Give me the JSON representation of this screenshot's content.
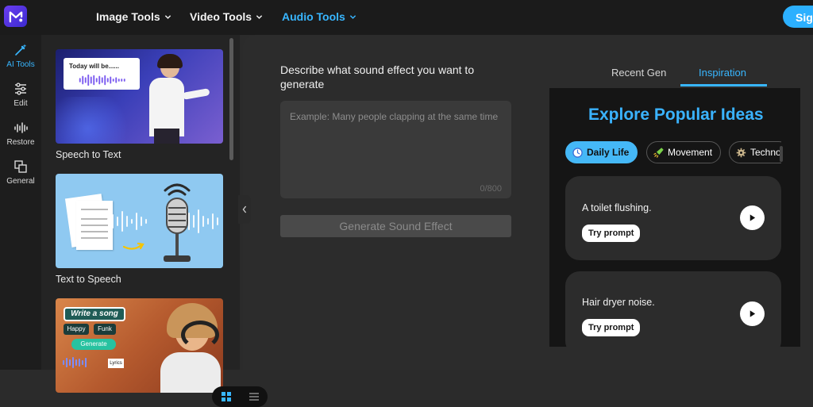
{
  "header": {
    "nav": [
      {
        "label": "Image Tools"
      },
      {
        "label": "Video Tools"
      },
      {
        "label": "Audio Tools"
      }
    ],
    "signin_label": "Sig"
  },
  "rail": {
    "items": [
      {
        "label": "AI Tools",
        "icon": "magic-wand-icon"
      },
      {
        "label": "Edit",
        "icon": "sliders-icon"
      },
      {
        "label": "Restore",
        "icon": "waveform-icon"
      },
      {
        "label": "General",
        "icon": "copy-icon"
      }
    ]
  },
  "tools": {
    "cards": [
      {
        "label": "Speech to Text",
        "overlay": "Today will be......"
      },
      {
        "label": "Text to Speech"
      },
      {
        "label": "",
        "overlay": "Write a song",
        "tags": [
          "Happy",
          "Funk"
        ],
        "button": "Generate",
        "badge": "Lyrics"
      }
    ]
  },
  "main": {
    "prompt_label": "Describe what sound effect you want to generate",
    "textarea_placeholder": "Example: Many people clapping at the same time",
    "char_count": "0/800",
    "generate_label": "Generate Sound Effect"
  },
  "right": {
    "tabs": [
      {
        "label": "Recent Gen"
      },
      {
        "label": "Inspiration"
      }
    ],
    "title": "Explore Popular Ideas",
    "chips": [
      {
        "label": "Daily Life",
        "icon": "clock-icon"
      },
      {
        "label": "Movement",
        "icon": "rocket-icon"
      },
      {
        "label": "Techno",
        "icon": "gear-icon"
      }
    ],
    "ideas": [
      {
        "text": "A toilet flushing.",
        "button": "Try prompt"
      },
      {
        "text": "Hair dryer noise.",
        "button": "Try prompt"
      }
    ]
  },
  "colors": {
    "accent": "#38b6ff",
    "brand": "#5b38e8",
    "background": "#2c2c2c"
  }
}
